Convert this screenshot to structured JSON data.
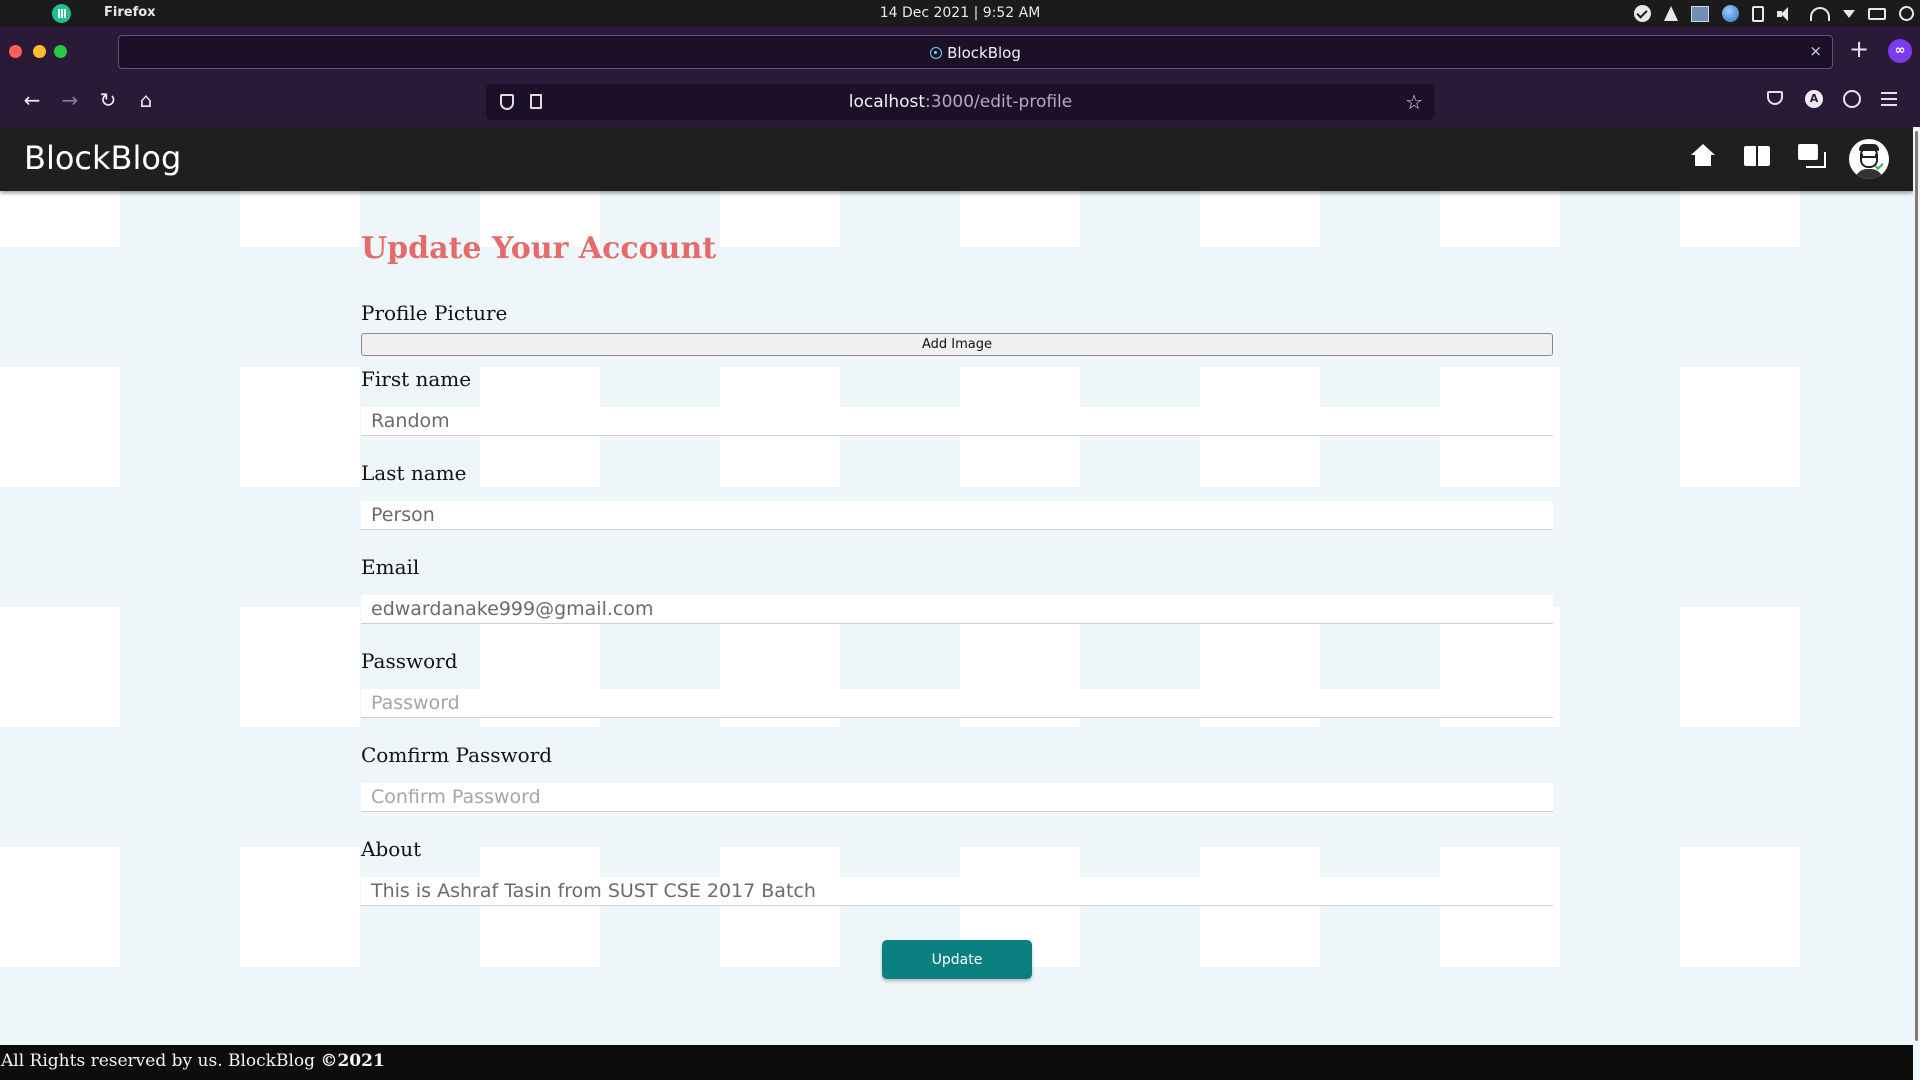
{
  "os": {
    "app_name": "Firefox",
    "clock": "14 Dec 2021 | 9:52 AM"
  },
  "browser": {
    "tab_title": "BlockBlog",
    "tab_close": "×",
    "new_tab": "+",
    "url_host": "localhost",
    "url_path": ":3000/edit-profile",
    "account_initial": "A",
    "window_controls": {
      "close": "#ff5f57",
      "minimize": "#febc2e",
      "maximize": "#28c840"
    }
  },
  "site": {
    "brand": "BlockBlog",
    "footer_text": "All Rights reserved by us. BlockBlog ",
    "footer_year": "©2021"
  },
  "form": {
    "title": "Update Your Account",
    "profile_picture_label": "Profile Picture",
    "add_image_label": "Add Image",
    "first_name_label": "First name",
    "first_name_value": "Random",
    "last_name_label": "Last name",
    "last_name_value": "Person",
    "email_label": "Email",
    "email_value": "edwardanake999@gmail.com",
    "password_label": "Password",
    "password_placeholder": "Password",
    "confirm_label": "Comfirm Password",
    "confirm_placeholder": "Confirm Password",
    "about_label": "About",
    "about_value": "This is Ashraf Tasin from SUST CSE 2017 Batch",
    "submit_label": "Update"
  },
  "colors": {
    "accent_title": "#e56b6b",
    "submit_button": "#0b8081",
    "header_bg": "#1f1f1f",
    "browser_chrome": "#2b1a37"
  }
}
